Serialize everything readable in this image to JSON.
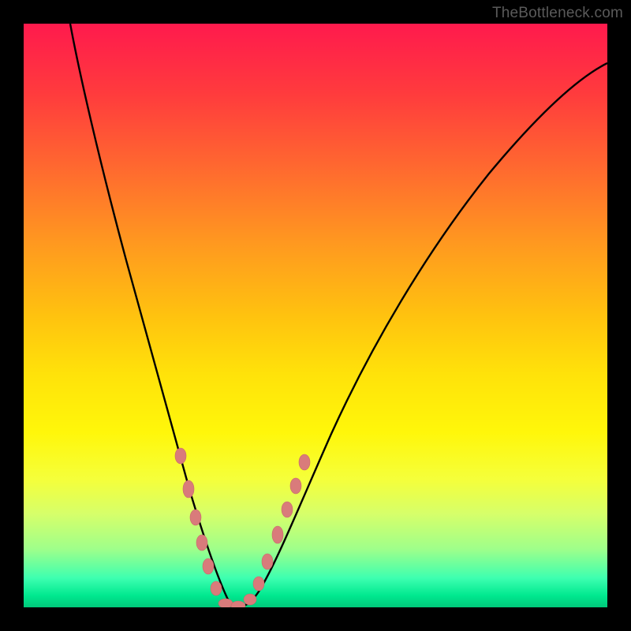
{
  "watermark": "TheBottleneck.com",
  "colors": {
    "frame": "#000000",
    "gradient_top": "#ff1a4d",
    "gradient_bottom": "#00c97a",
    "curve": "#000000",
    "marker": "#d97b7b"
  },
  "chart_data": {
    "type": "line",
    "title": "",
    "xlabel": "",
    "ylabel": "",
    "xlim": [
      0,
      100
    ],
    "ylim": [
      0,
      100
    ],
    "grid": false,
    "legend": false,
    "notes": "V-shaped bottleneck curve reaching minimum near x≈35 at y≈0; background gradient encodes severity (red high, green low). Axes are unlabeled; values are approximate positions (percent of axis range).",
    "series": [
      {
        "name": "bottleneck-curve",
        "x": [
          8,
          10,
          12,
          15,
          18,
          20,
          23,
          26,
          28,
          30,
          32,
          34,
          36,
          38,
          40,
          43,
          46,
          50,
          55,
          60,
          66,
          72,
          78,
          85,
          92,
          98
        ],
        "y": [
          100,
          90,
          80,
          68,
          56,
          48,
          38,
          28,
          20,
          12,
          6,
          1,
          0,
          1,
          4,
          10,
          18,
          28,
          38,
          48,
          58,
          66,
          73,
          80,
          86,
          90
        ]
      }
    ],
    "markers": [
      {
        "x": 27,
        "y": 26
      },
      {
        "x": 28.5,
        "y": 20
      },
      {
        "x": 29.5,
        "y": 15
      },
      {
        "x": 30.5,
        "y": 11
      },
      {
        "x": 31.5,
        "y": 7
      },
      {
        "x": 32.8,
        "y": 3
      },
      {
        "x": 34.5,
        "y": 0.5
      },
      {
        "x": 36.5,
        "y": 0.5
      },
      {
        "x": 38.5,
        "y": 2
      },
      {
        "x": 40,
        "y": 5
      },
      {
        "x": 41.5,
        "y": 9
      },
      {
        "x": 43.5,
        "y": 14
      },
      {
        "x": 45,
        "y": 18
      },
      {
        "x": 46.5,
        "y": 22
      },
      {
        "x": 48,
        "y": 26
      }
    ]
  }
}
